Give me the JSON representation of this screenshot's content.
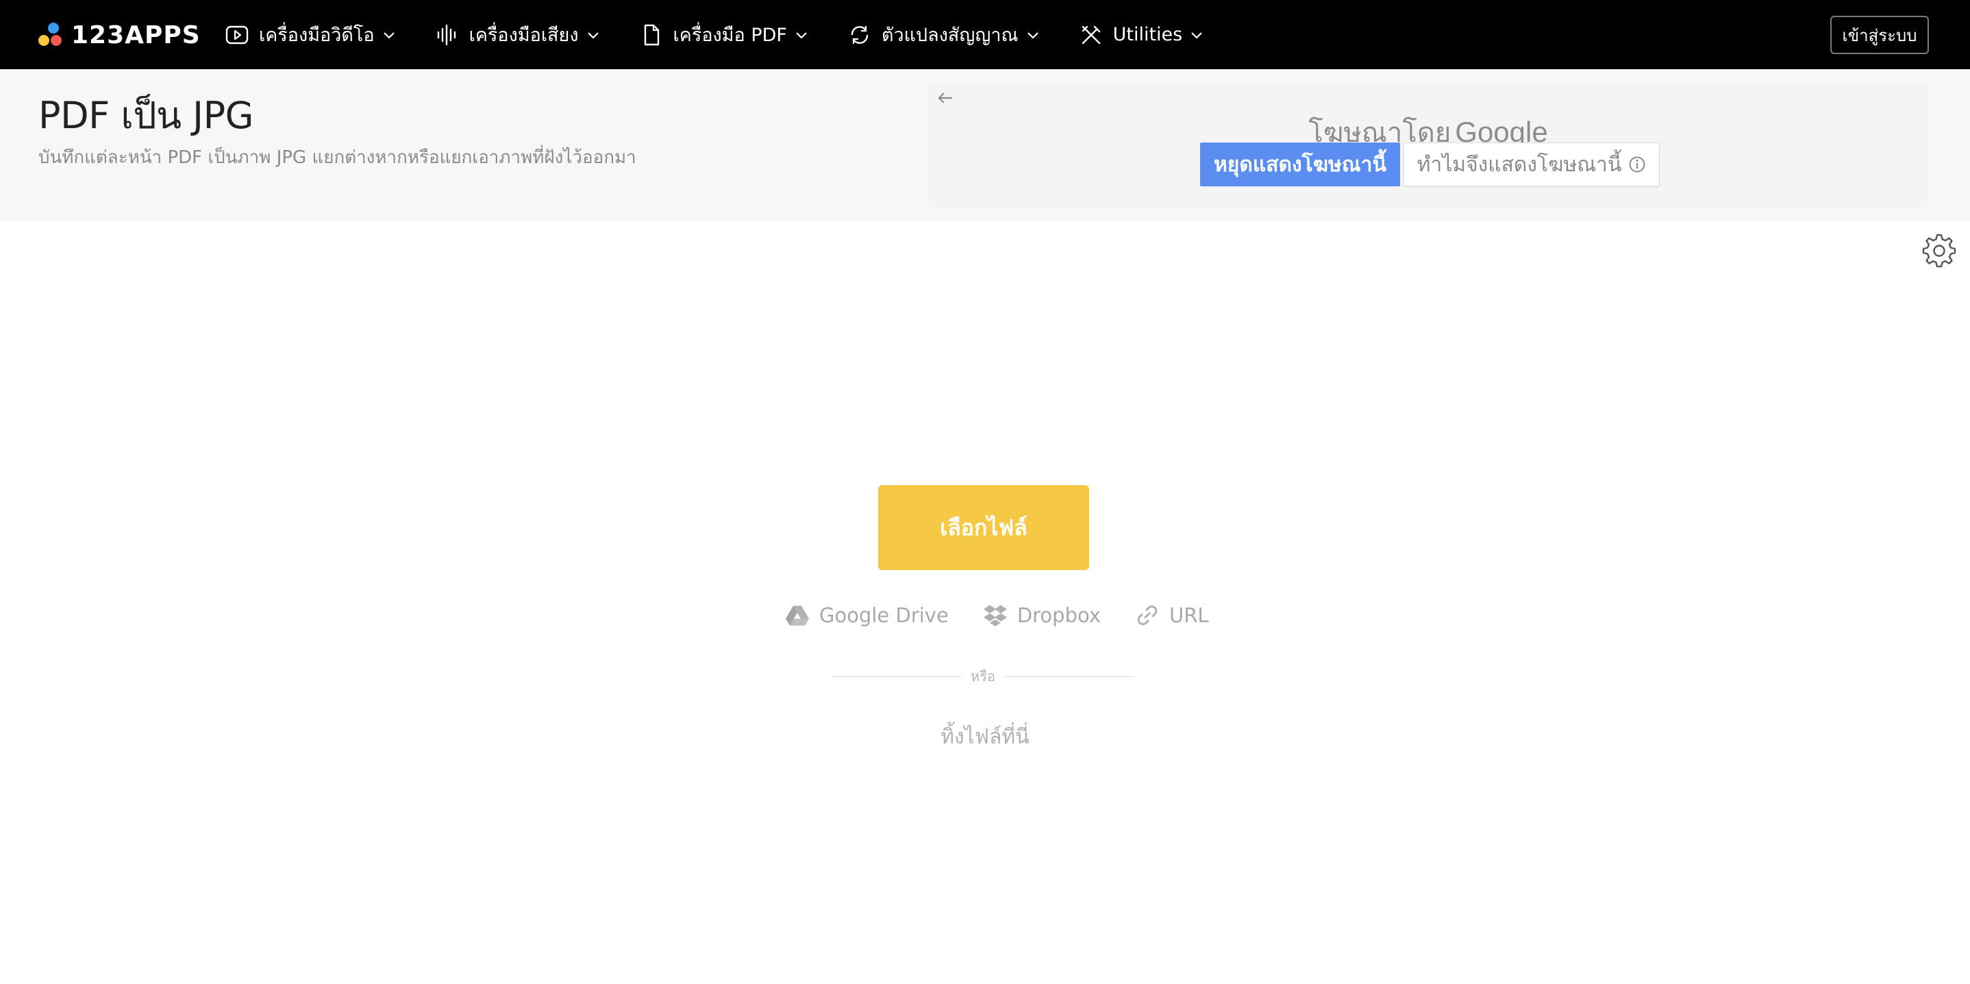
{
  "brand": {
    "name": "123APPS",
    "dot_colors": [
      "#3b9cf0",
      "#f5c83d",
      "#f05a4f"
    ]
  },
  "nav": {
    "items": [
      {
        "label": "เครื่องมือวิดีโอ",
        "icon": "video-play-icon"
      },
      {
        "label": "เครื่องมือเสียง",
        "icon": "audio-waveform-icon"
      },
      {
        "label": "เครื่องมือ PDF",
        "icon": "document-icon"
      },
      {
        "label": "ตัวแปลงสัญญาณ",
        "icon": "convert-cycle-icon"
      },
      {
        "label": "Utilities",
        "icon": "tools-icon"
      }
    ],
    "login_label": "เข้าสู่ระบบ"
  },
  "header": {
    "title": "PDF เป็น JPG",
    "subtitle": "บันทึกแต่ละหน้า PDF เป็นภาพ JPG แยกต่างหากหรือแยกเอาภาพที่ฝังไว้ออกมา"
  },
  "ad": {
    "ads_by_label": "โฆษณาโดย",
    "ads_by_brand": "Google",
    "stop_label": "หยุดแสดงโฆษณานี้",
    "why_label": "ทำไมจึงแสดงโฆษณานี้",
    "stop_color": "#5b8df0"
  },
  "upload": {
    "choose_label": "เลือกไฟล์",
    "choose_color": "#f6c944",
    "sources": [
      {
        "label": "Google Drive",
        "icon": "google-drive-icon"
      },
      {
        "label": "Dropbox",
        "icon": "dropbox-icon"
      },
      {
        "label": "URL",
        "icon": "link-icon"
      }
    ],
    "or_label": "หรือ",
    "drop_label": "ทิ้งไฟล์ที่นี่"
  }
}
